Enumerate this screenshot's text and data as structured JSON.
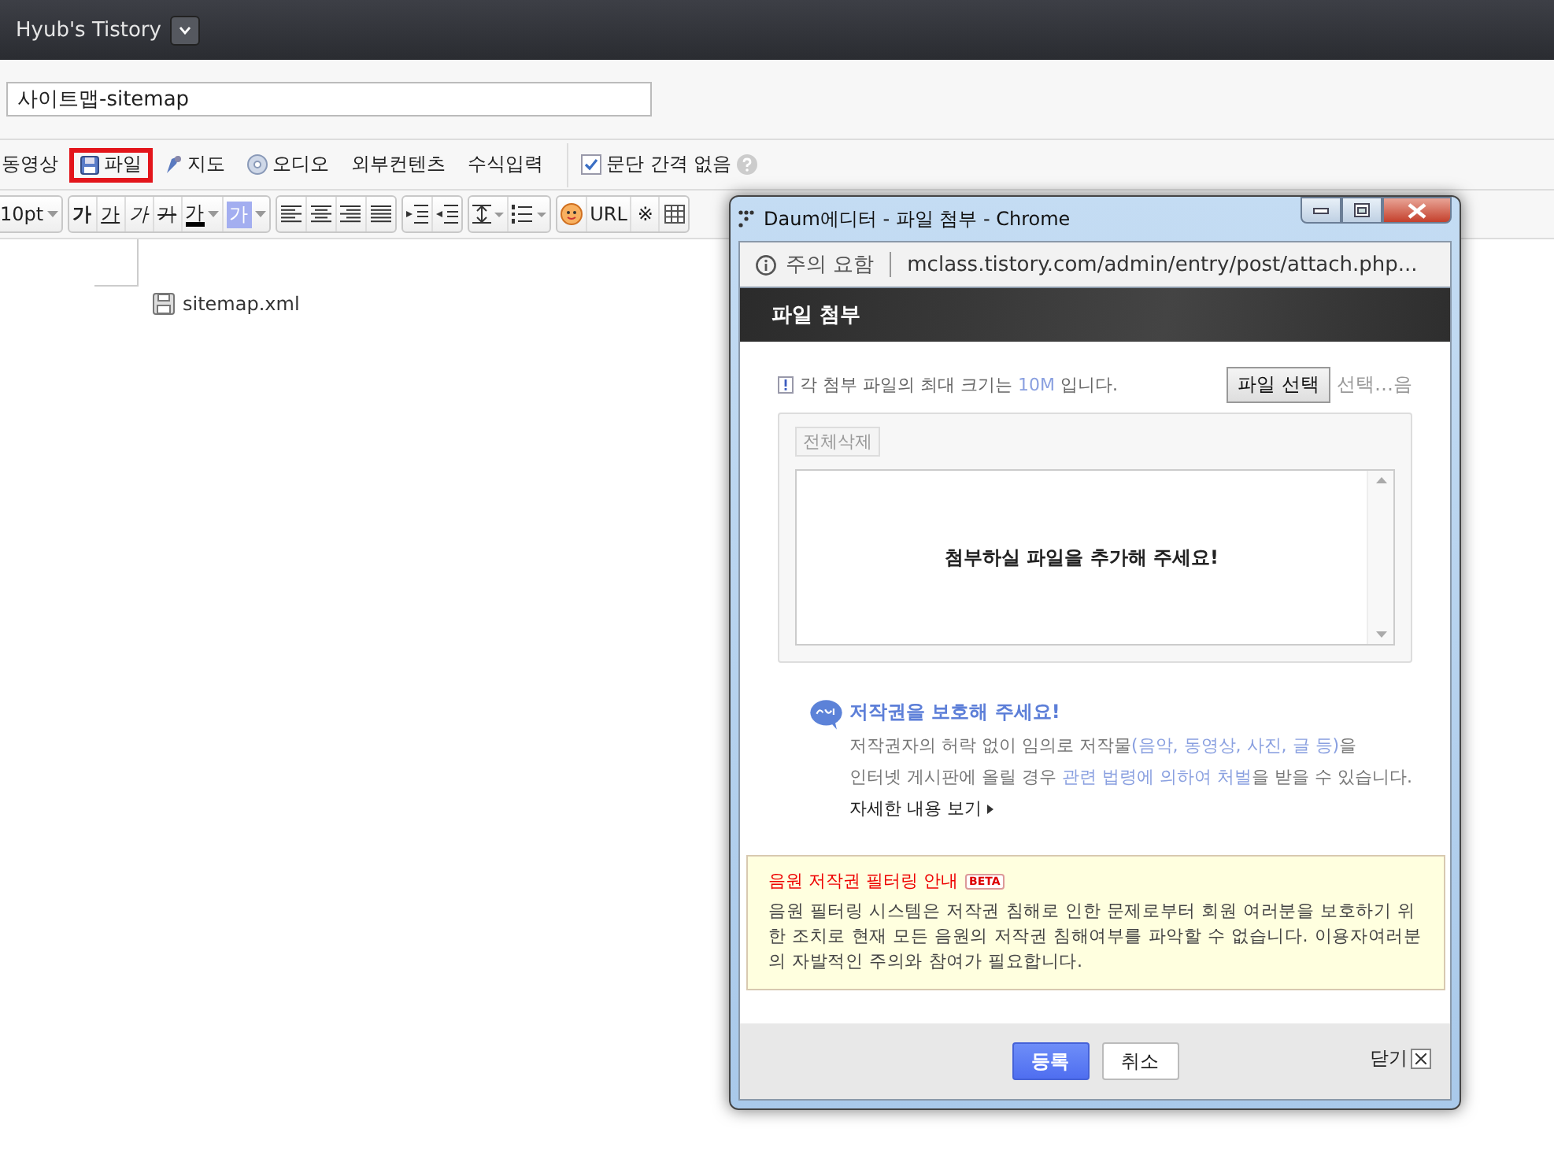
{
  "blog_title": "Hyub's Tistory",
  "title_field": {
    "value": "사이트맵-sitemap"
  },
  "insert_toolbar": [
    {
      "label": "동영상",
      "selected": false
    },
    {
      "label": "파일",
      "selected": true
    },
    {
      "label": "지도",
      "selected": false
    },
    {
      "label": "오디오",
      "selected": false
    },
    {
      "label": "외부컨텐츠",
      "selected": false
    },
    {
      "label": "수식입력",
      "selected": false
    }
  ],
  "paragraph_option": {
    "label": "문단 간격 없음",
    "checked": true
  },
  "format_toolbar": {
    "font_size": "10pt",
    "text_styles": [
      "가",
      "가",
      "가",
      "가",
      "가",
      "가"
    ],
    "insert_texts": [
      "URL",
      "※"
    ]
  },
  "editor": {
    "attachment": "sitemap.xml"
  },
  "popup": {
    "window_title": "Daum에디터 - 파일 첨부 - Chrome",
    "security": "주의 요함",
    "url": "mclass.tistory.com/admin/entry/post/attach.php...",
    "header": "파일 첨부",
    "notice": [
      {
        "text": "각 첨부 파일의 최대 크기는 ",
        "highlight": false
      },
      {
        "text": "10M",
        "highlight": true
      },
      {
        "text": " 입니다.",
        "highlight": false
      }
    ],
    "file_button": "파일 선택",
    "file_status": "선택…음",
    "delete_all": "전체삭제",
    "empty_message": "첨부하실 파일을 추가해 주세요!",
    "copyright_title": "저작권을 보호해 주세요!",
    "copyright_lines": [
      [
        {
          "text": "저작권자의 허락 없이 임의로 저작물",
          "highlight": false
        },
        {
          "text": "(음악, 동영상, 사진, 글 등)",
          "highlight": true
        },
        {
          "text": "을",
          "highlight": false
        }
      ],
      [
        {
          "text": "인터넷 게시판에 올릴 경우 ",
          "highlight": false
        },
        {
          "text": "관련 법령에 의하여 처벌",
          "highlight": true
        },
        {
          "text": "을 받을 수 있습니다.",
          "highlight": false
        }
      ]
    ],
    "more_link": "자세한 내용 보기",
    "filter_title": "음원 저작권 필터링 안내",
    "filter_badge": "BETA",
    "filter_text": "음원 필터링 시스템은 저작권 침해로 인한 문제로부터 회원 여러분을 보호하기 위한 조치로 현재 모든 음원의 저작권 침해여부를 파악할 수 없습니다. 이용자여러분의 자발적인 주의와 참여가 필요합니다.",
    "buttons": [
      {
        "label": "등록",
        "kind": "primary"
      },
      {
        "label": "취소",
        "kind": "secondary"
      }
    ],
    "close_label": "닫기"
  }
}
